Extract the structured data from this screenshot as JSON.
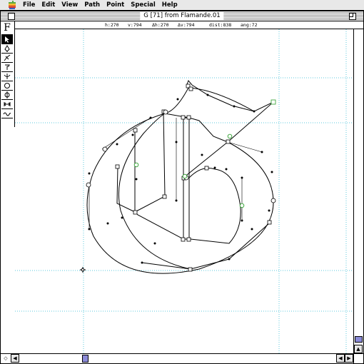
{
  "menubar": {
    "items": [
      "File",
      "Edit",
      "View",
      "Path",
      "Point",
      "Special",
      "Help"
    ]
  },
  "window": {
    "title": "G [71] from Flamande.01"
  },
  "infobar": {
    "h": "h:270",
    "v": "v:794",
    "dh": "Δh:270",
    "dv": "Δv:794",
    "dist": "dist:838",
    "ang": "ang:72"
  },
  "toolbox": {
    "tools": [
      {
        "name": "font-logo-icon",
        "glyph": "F"
      },
      {
        "name": "arrow-tool-icon",
        "glyph": "↖",
        "selected": true
      },
      {
        "name": "pen-tool-icon",
        "glyph": "✒"
      },
      {
        "name": "freehand-tool-icon",
        "glyph": "★"
      },
      {
        "name": "knife-tool-icon",
        "glyph": "†"
      },
      {
        "name": "corner-point-icon",
        "glyph": "↓"
      },
      {
        "name": "curve-point-icon",
        "glyph": "○"
      },
      {
        "name": "tangent-point-icon",
        "glyph": "◇"
      },
      {
        "name": "measure-tool-icon",
        "glyph": "↔"
      },
      {
        "name": "rotate-tool-icon",
        "glyph": "∿"
      }
    ]
  },
  "colors": {
    "guide": "#5ec8dc",
    "outline": "#000000",
    "tangent": "#2a9d2a",
    "scroll_thumb": "#8b8bd8"
  }
}
